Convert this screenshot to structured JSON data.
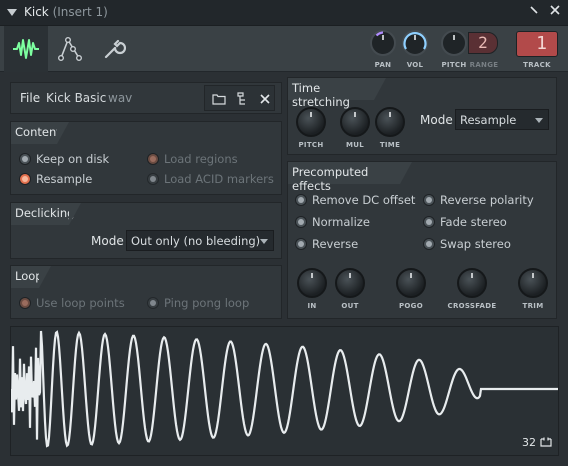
{
  "window": {
    "title": "Kick",
    "subtitle": "(Insert 1)",
    "menu_icon": "triangle-down-icon",
    "minimize_icon": "minimize-icon",
    "close_icon": "close-icon"
  },
  "toolbar": {
    "tabs": [
      "sample-icon",
      "envelope-icon",
      "wrench-icon"
    ],
    "knobs": {
      "pan": "PAN",
      "vol": "VOL",
      "pitch": "PITCH"
    },
    "range_label": "RANGE",
    "range_value": "2",
    "track_label": "TRACK",
    "track_value": "1",
    "accent_color": "#7dffa0",
    "knob_accent": "#8fd0ff",
    "track_color": "#b24a4a"
  },
  "file": {
    "label": "File",
    "name": "Kick Basic",
    "ext": "wav"
  },
  "content": {
    "header": "Content",
    "keep_on_disk": "Keep on disk",
    "resample": "Resample",
    "load_regions": "Load regions",
    "load_acid": "Load ACID markers"
  },
  "declicking": {
    "header": "Declicking",
    "mode_label": "Mode",
    "mode_value": "Out only (no bleeding)"
  },
  "loop": {
    "header": "Loop",
    "use_loop_points": "Use loop points",
    "ping_pong": "Ping pong loop"
  },
  "time_stretching": {
    "header": "Time stretching",
    "knobs": [
      "PITCH",
      "MUL",
      "TIME"
    ],
    "mode_label": "Mode",
    "mode_value": "Resample"
  },
  "precomputed": {
    "header": "Precomputed effects",
    "left": [
      "Remove DC offset",
      "Normalize",
      "Reverse"
    ],
    "right": [
      "Reverse polarity",
      "Fade stereo",
      "Swap stereo"
    ],
    "knobs": [
      "IN",
      "OUT",
      "POGO",
      "CROSSFADE",
      "TRIM"
    ]
  },
  "waveform": {
    "zoom": "32"
  }
}
